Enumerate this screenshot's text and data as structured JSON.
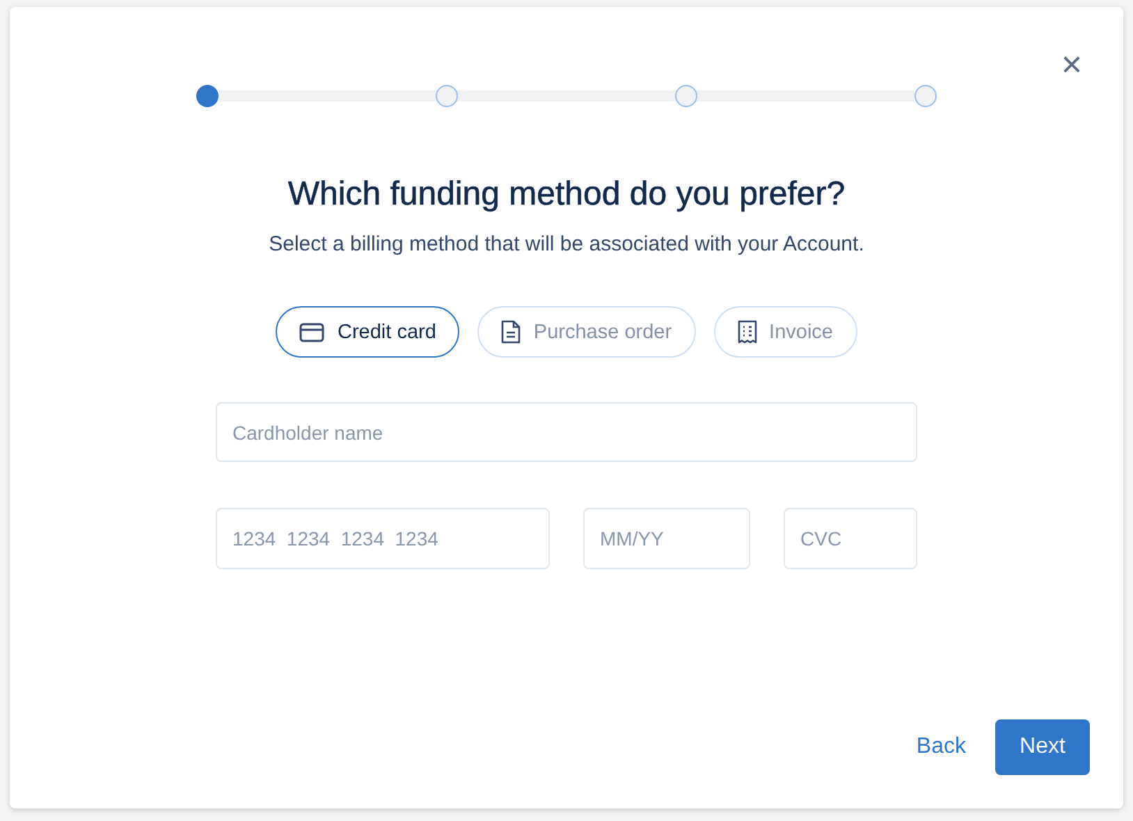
{
  "close_label": "×",
  "steps": [
    {
      "selected": true
    },
    {
      "selected": false
    },
    {
      "selected": false
    },
    {
      "selected": false
    }
  ],
  "title": "Which funding method do you prefer?",
  "subtitle": "Select a billing method that will be associated with your Account.",
  "methods": [
    {
      "kind": "card",
      "label": "Credit card",
      "selected": true
    },
    {
      "kind": "document",
      "label": "Purchase order",
      "selected": false
    },
    {
      "kind": "receipt",
      "label": "Invoice",
      "selected": false
    }
  ],
  "fields": {
    "cardholder": {
      "placeholder": "Cardholder name"
    },
    "card_number": {
      "placeholder": "1234  1234  1234  1234"
    },
    "expiry": {
      "placeholder": "MM/YY"
    },
    "cvc": {
      "placeholder": "CVC"
    }
  },
  "buttons": {
    "back": "Back",
    "next": "Next"
  }
}
